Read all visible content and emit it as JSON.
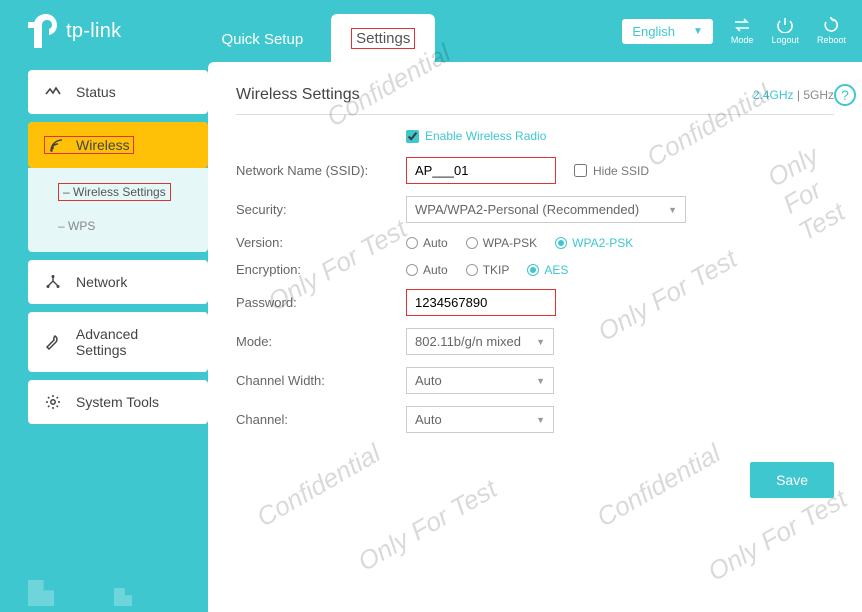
{
  "brand": "tp-link",
  "tabs": {
    "quick": "Quick Setup",
    "settings": "Settings"
  },
  "header": {
    "language": "English",
    "mode": "Mode",
    "logout": "Logout",
    "reboot": "Reboot"
  },
  "sidebar": {
    "status": "Status",
    "wireless": "Wireless",
    "sub": {
      "ws": "Wireless Settings",
      "wps": "WPS"
    },
    "network": "Network",
    "advanced": "Advanced Settings",
    "system": "System Tools"
  },
  "page": {
    "title": "Wireless Settings",
    "band24": "2.4GHz",
    "sep": " | ",
    "band5": "5GHz",
    "enable": "Enable Wireless Radio",
    "ssid_label": "Network Name (SSID):",
    "ssid_value": "AP___01",
    "hide": "Hide SSID",
    "security_label": "Security:",
    "security_value": "WPA/WPA2-Personal (Recommended)",
    "version_label": "Version:",
    "version_opts": {
      "auto": "Auto",
      "wpa": "WPA-PSK",
      "wpa2": "WPA2-PSK"
    },
    "encryption_label": "Encryption:",
    "encryption_opts": {
      "auto": "Auto",
      "tkip": "TKIP",
      "aes": "AES"
    },
    "password_label": "Password:",
    "password_value": "1234567890",
    "mode_label": "Mode:",
    "mode_value": "802.11b/g/n mixed",
    "cw_label": "Channel Width:",
    "cw_value": "Auto",
    "ch_label": "Channel:",
    "ch_value": "Auto",
    "save": "Save"
  },
  "watermarks": [
    "Confidential",
    "Only For Test"
  ]
}
